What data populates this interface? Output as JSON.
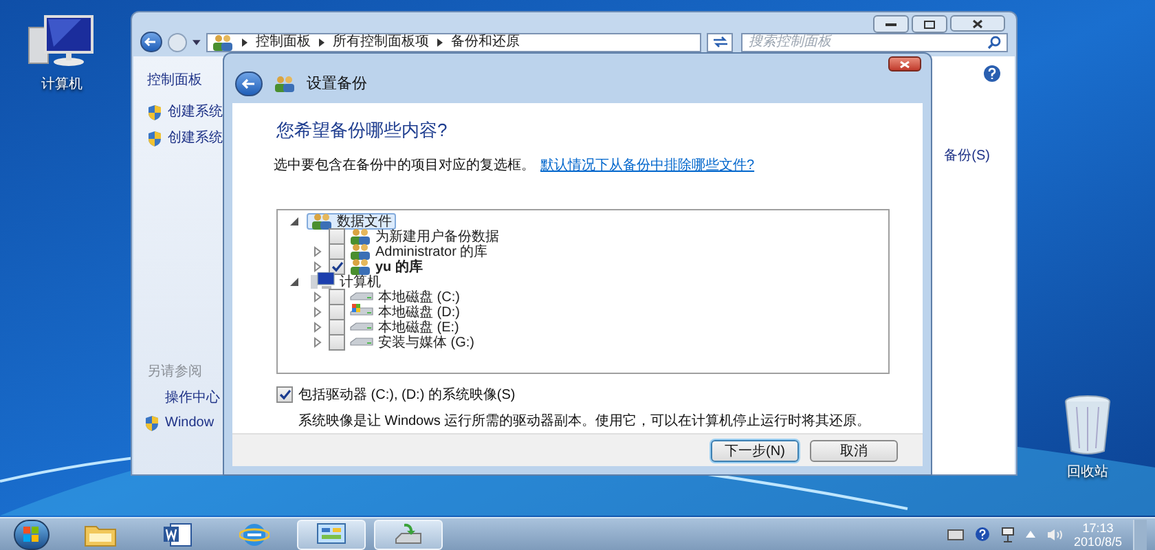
{
  "desktop_icons": [
    {
      "label": "计算机",
      "kind": "computer"
    },
    {
      "label": "回收站",
      "kind": "recycle-bin"
    }
  ],
  "control_panel": {
    "breadcrumbs": [
      "控制面板",
      "所有控制面板项",
      "备份和还原"
    ],
    "search": {
      "placeholder": "搜索控制面板"
    },
    "sidebar": {
      "home": "控制面板",
      "tasks": [
        "创建系统",
        "创建系统"
      ],
      "see_also_heading": "另请参阅",
      "see_also": [
        {
          "label": "操作中心",
          "shield": false
        },
        {
          "label": "Window",
          "shield": true
        }
      ]
    },
    "main_link": "备份(S)"
  },
  "dialog": {
    "title": "设置备份",
    "heading": "您希望备份哪些内容?",
    "instruction": "选中要包含在备份中的项目对应的复选框。",
    "help_link": "默认情况下从备份中排除哪些文件?",
    "tree": [
      {
        "label": "数据文件",
        "kind": "library",
        "expanded": true,
        "selected": true,
        "children": [
          {
            "label": "为新建用户备份数据",
            "kind": "library",
            "checked": false
          },
          {
            "label": "Administrator 的库",
            "kind": "library",
            "checked": false,
            "expanded": false
          },
          {
            "label": "yu 的库",
            "kind": "library",
            "checked": true,
            "expanded": false
          }
        ]
      },
      {
        "label": "计算机",
        "kind": "computer",
        "expanded": true,
        "selected": false,
        "children": [
          {
            "label": "本地磁盘 (C:)",
            "kind": "drive",
            "checked": false,
            "expanded": false
          },
          {
            "label": "本地磁盘 (D:)",
            "kind": "system-drive",
            "checked": false,
            "expanded": false
          },
          {
            "label": "本地磁盘 (E:)",
            "kind": "drive",
            "checked": false,
            "expanded": false
          },
          {
            "label": "安装与媒体 (G:)",
            "kind": "drive",
            "checked": false,
            "expanded": false
          }
        ]
      }
    ],
    "system_image": {
      "label": "包括驱动器 (C:), (D:) 的系统映像(S)",
      "checked": true,
      "description": "系统映像是让 Windows 运行所需的驱动器副本。使用它，可以在计算机停止运行时将其还原。"
    },
    "buttons": [
      {
        "label": "下一步(N)",
        "default": true
      },
      {
        "label": "取消",
        "default": false
      }
    ]
  },
  "taskbar": {
    "apps": [
      {
        "kind": "explorer",
        "open": false
      },
      {
        "kind": "word",
        "open": false
      },
      {
        "kind": "browser",
        "open": false
      },
      {
        "kind": "control-panel",
        "open": true
      },
      {
        "kind": "backup",
        "open": true
      }
    ],
    "time": "17:13",
    "date": "2010/8/5"
  }
}
